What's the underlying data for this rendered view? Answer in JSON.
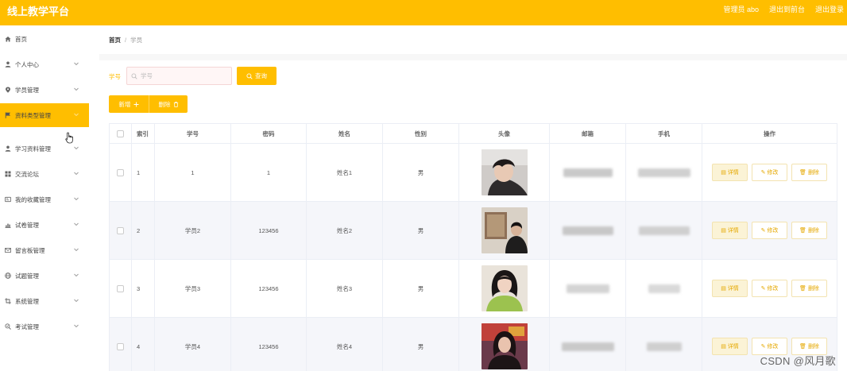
{
  "header": {
    "brand": "线上教学平台",
    "user": "管理员 abo",
    "exit_backend": "退出到前台",
    "logout": "退出登录"
  },
  "sidebar": {
    "items": [
      {
        "label": "首页",
        "icon": "home-icon",
        "has_children": false,
        "active": false
      },
      {
        "label": "个人中心",
        "icon": "user-icon",
        "has_children": true,
        "active": false
      },
      {
        "label": "学员管理",
        "icon": "location-icon",
        "has_children": true,
        "active": false
      },
      {
        "label": "资料类型管理",
        "icon": "flag-icon",
        "has_children": true,
        "active": true
      },
      {
        "label": "学习资料管理",
        "icon": "user-icon",
        "has_children": true,
        "active": false
      },
      {
        "label": "交流论坛",
        "icon": "grid-icon",
        "has_children": true,
        "active": false
      },
      {
        "label": "我的收藏管理",
        "icon": "card-icon",
        "has_children": true,
        "active": false
      },
      {
        "label": "试卷管理",
        "icon": "chart-icon",
        "has_children": true,
        "active": false
      },
      {
        "label": "留言板管理",
        "icon": "mail-icon",
        "has_children": true,
        "active": false
      },
      {
        "label": "试题管理",
        "icon": "globe-icon",
        "has_children": true,
        "active": false
      },
      {
        "label": "系统管理",
        "icon": "crop-icon",
        "has_children": true,
        "active": false
      },
      {
        "label": "考试管理",
        "icon": "exam-icon",
        "has_children": true,
        "active": false
      }
    ]
  },
  "breadcrumb": {
    "home": "首页",
    "separator": "/",
    "current": "学员"
  },
  "search": {
    "label": "学号",
    "placeholder": "学号",
    "button": "查询"
  },
  "toolbar": {
    "add": "新增",
    "delete": "删除"
  },
  "table": {
    "columns": [
      "索引",
      "学号",
      "密码",
      "姓名",
      "性别",
      "头像",
      "邮箱",
      "手机",
      "操作"
    ],
    "rows": [
      {
        "index": "1",
        "student_id": "1",
        "password": "1",
        "name": "姓名1",
        "gender": "男",
        "avatar": "avatar-male-1"
      },
      {
        "index": "2",
        "student_id": "学员2",
        "password": "123456",
        "name": "姓名2",
        "gender": "男",
        "avatar": "avatar-male-2"
      },
      {
        "index": "3",
        "student_id": "学员3",
        "password": "123456",
        "name": "姓名3",
        "gender": "男",
        "avatar": "avatar-female-1"
      },
      {
        "index": "4",
        "student_id": "学员4",
        "password": "123456",
        "name": "姓名4",
        "gender": "男",
        "avatar": "avatar-female-2"
      }
    ],
    "actions": {
      "detail": "详情",
      "edit": "修改",
      "delete": "删除"
    }
  },
  "watermark": "CSDN @风月歌",
  "colors": {
    "accent": "#FFBE00",
    "row_alt": "#F5F6FA"
  }
}
